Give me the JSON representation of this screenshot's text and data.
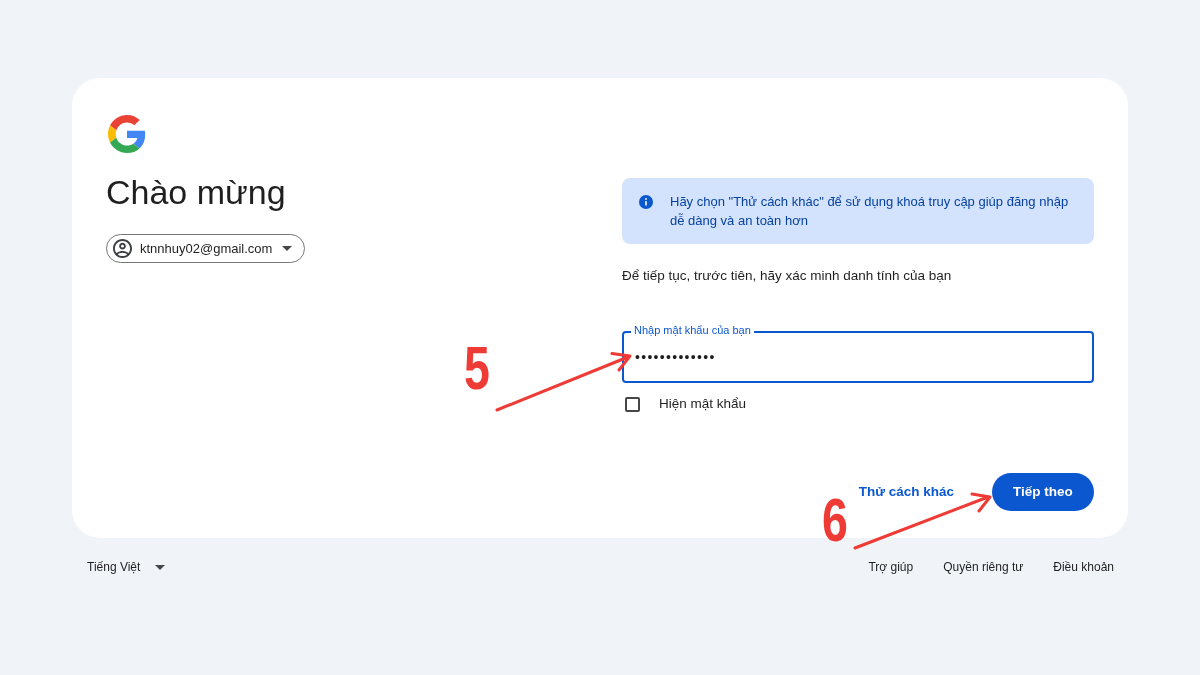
{
  "heading": "Chào mừng",
  "account": {
    "email": "ktnnhuy02@gmail.com"
  },
  "info_banner": {
    "text": "Hãy chọn \"Thử cách khác\" để sử dụng khoá truy cập giúp đăng nhập dễ dàng và an toàn hơn"
  },
  "prompt": "Để tiếp tục, trước tiên, hãy xác minh danh tính của bạn",
  "password_field": {
    "label": "Nhập mật khẩu của bạn",
    "value": "•••••••••••••",
    "focused": true
  },
  "show_password": {
    "label": "Hiện mật khẩu",
    "checked": false
  },
  "actions": [
    {
      "kind": "link",
      "label": "Thử cách khác"
    },
    {
      "kind": "primary",
      "label": "Tiếp theo"
    }
  ],
  "footer": {
    "language": "Tiếng Việt",
    "links": [
      "Trợ giúp",
      "Quyền riêng tư",
      "Điều khoản"
    ]
  },
  "annotations": [
    {
      "label": "5"
    },
    {
      "label": "6"
    }
  ]
}
